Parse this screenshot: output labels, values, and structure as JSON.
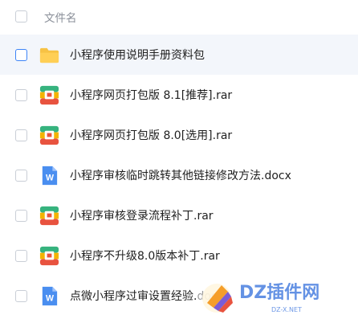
{
  "header": {
    "column_name": "文件名"
  },
  "files": [
    {
      "name": "小程序使用说明手册资料包",
      "icon": "folder-icon"
    },
    {
      "name": "小程序网页打包版 8.1[推荐].rar",
      "icon": "archive-icon"
    },
    {
      "name": "小程序网页打包版 8.0[选用].rar",
      "icon": "archive-icon"
    },
    {
      "name": "小程序审核临时跳转其他链接修改方法.docx",
      "icon": "word-doc-icon"
    },
    {
      "name": "小程序审核登录流程补丁.rar",
      "icon": "archive-icon"
    },
    {
      "name": "小程序不升级8.0版本补丁.rar",
      "icon": "archive-icon"
    },
    {
      "name": "点微小程序过审设置经验.doc",
      "icon": "word-doc-icon"
    }
  ],
  "watermark": {
    "text": "DZ插件网",
    "subtext": "DZ-X.NET"
  },
  "colors": {
    "accent": "#3d84f7",
    "folder": "#f7c244",
    "word": "#4a8ef0"
  }
}
